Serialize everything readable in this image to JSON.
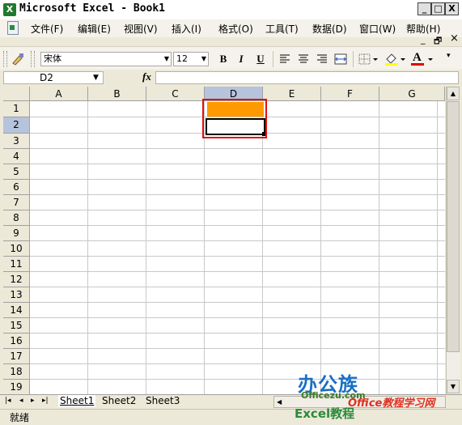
{
  "window": {
    "title": "Microsoft Excel - Book1",
    "controls": {
      "minimize": "_",
      "restore": "□",
      "close": "X"
    },
    "doc_controls": {
      "minimize": "_",
      "restore": "🗗",
      "close": "×"
    }
  },
  "menubar": {
    "items": [
      "文件(F)",
      "编辑(E)",
      "视图(V)",
      "插入(I)",
      "格式(O)",
      "工具(T)",
      "数据(D)",
      "窗口(W)",
      "帮助(H)"
    ]
  },
  "toolbar": {
    "font": "宋体",
    "font_size": "12",
    "bold": "B",
    "italic": "I",
    "underline": "U",
    "font_color_letter": "A"
  },
  "formula_bar": {
    "name_box": "D2",
    "fx": "fx",
    "content": ""
  },
  "sheet": {
    "columns": [
      "A",
      "B",
      "C",
      "D",
      "E",
      "F",
      "G"
    ],
    "rows": [
      "1",
      "2",
      "3",
      "4",
      "5",
      "6",
      "7",
      "8",
      "9",
      "10",
      "11",
      "12",
      "13",
      "14",
      "15",
      "16",
      "17",
      "18",
      "19"
    ],
    "selected_cell": "D2",
    "filled_cell": "D1",
    "fill_color": "#ff9900",
    "highlight_color": "#e01010"
  },
  "tabs": {
    "nav": [
      "|◂",
      "◂",
      "▸",
      "▸|"
    ],
    "sheets": [
      "Sheet1",
      "Sheet2",
      "Sheet3"
    ],
    "active": "Sheet1"
  },
  "status": {
    "text": "就绪"
  },
  "watermarks": {
    "logo": "办公族",
    "site": "Officezu.com",
    "office68": "Office教程学习网",
    "excel": "Excel教程"
  }
}
